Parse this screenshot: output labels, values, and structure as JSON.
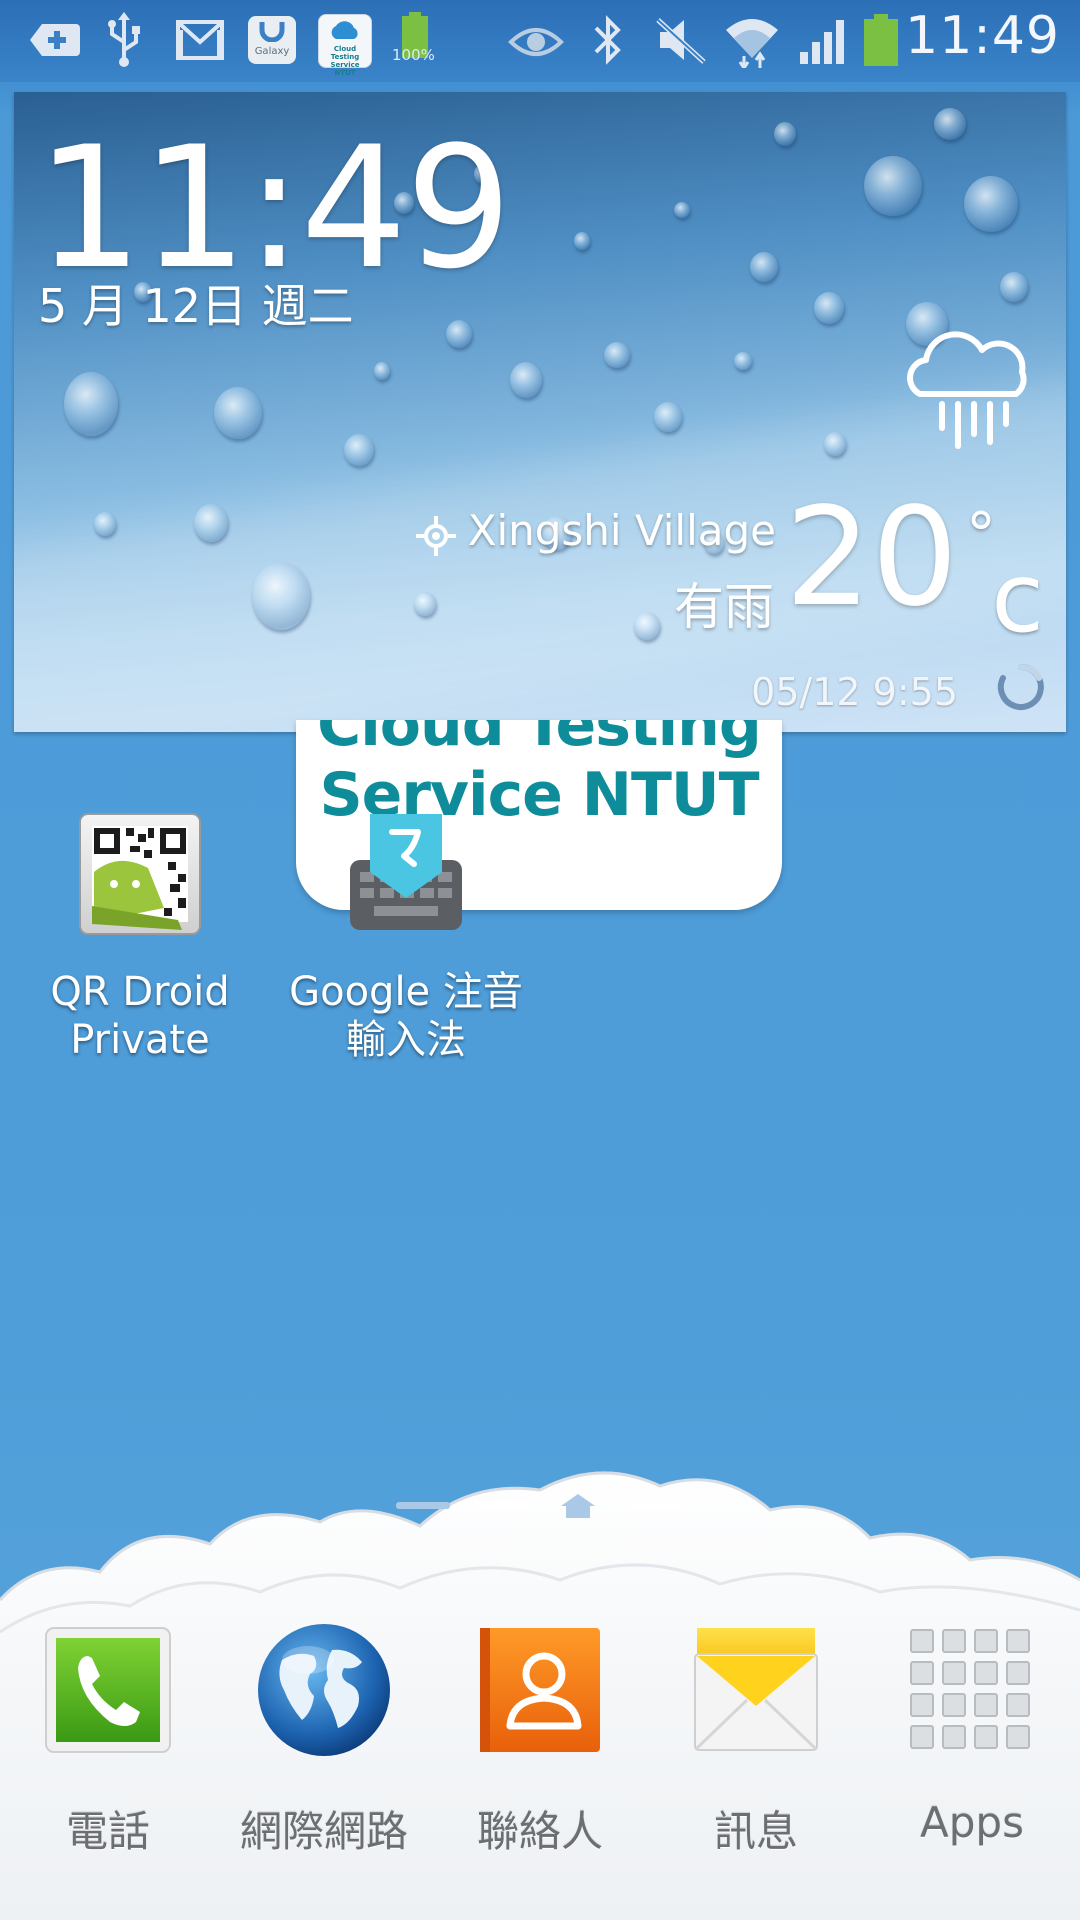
{
  "status_bar": {
    "time": "11:49",
    "battery_level": "100%",
    "icons": [
      "add-notification-icon",
      "usb-icon",
      "gmail-icon",
      "galaxy-apps-icon",
      "cloud-testing-icon",
      "battery-full-icon",
      "smart-stay-eye-icon",
      "bluetooth-icon",
      "sound-muted-icon",
      "wifi-icon",
      "signal-icon",
      "battery-icon"
    ],
    "galaxy_label": "Galaxy",
    "cloud_label": "Cloud Testing Service NTUT"
  },
  "weather_widget": {
    "time": "11:49",
    "date": "5 月 12日 週二",
    "location": "Xingshi Village",
    "condition": "有雨",
    "temperature": "20",
    "degree_symbol": "°",
    "unit": "c",
    "updated": "05/12 9:55",
    "weather_icon": "rain-cloud-icon"
  },
  "cloud_testing_widget": {
    "line1": "Cloud Testing",
    "line2": "Service NTUT"
  },
  "apps": [
    {
      "label_line1": "QR Droid",
      "label_line2": "Private",
      "icon": "qr-droid-icon"
    },
    {
      "label_line1": "Google 注音",
      "label_line2": "輸入法",
      "icon": "google-zhuyin-keyboard-icon"
    }
  ],
  "pager": {
    "pages": 4,
    "current_page": 2,
    "home_page": 3
  },
  "dock": [
    {
      "label": "電話",
      "icon": "phone-icon"
    },
    {
      "label": "網際網路",
      "icon": "internet-globe-icon"
    },
    {
      "label": "聯絡人",
      "icon": "contacts-icon"
    },
    {
      "label": "訊息",
      "icon": "messages-icon"
    },
    {
      "label": "Apps",
      "icon": "apps-grid-icon"
    }
  ]
}
